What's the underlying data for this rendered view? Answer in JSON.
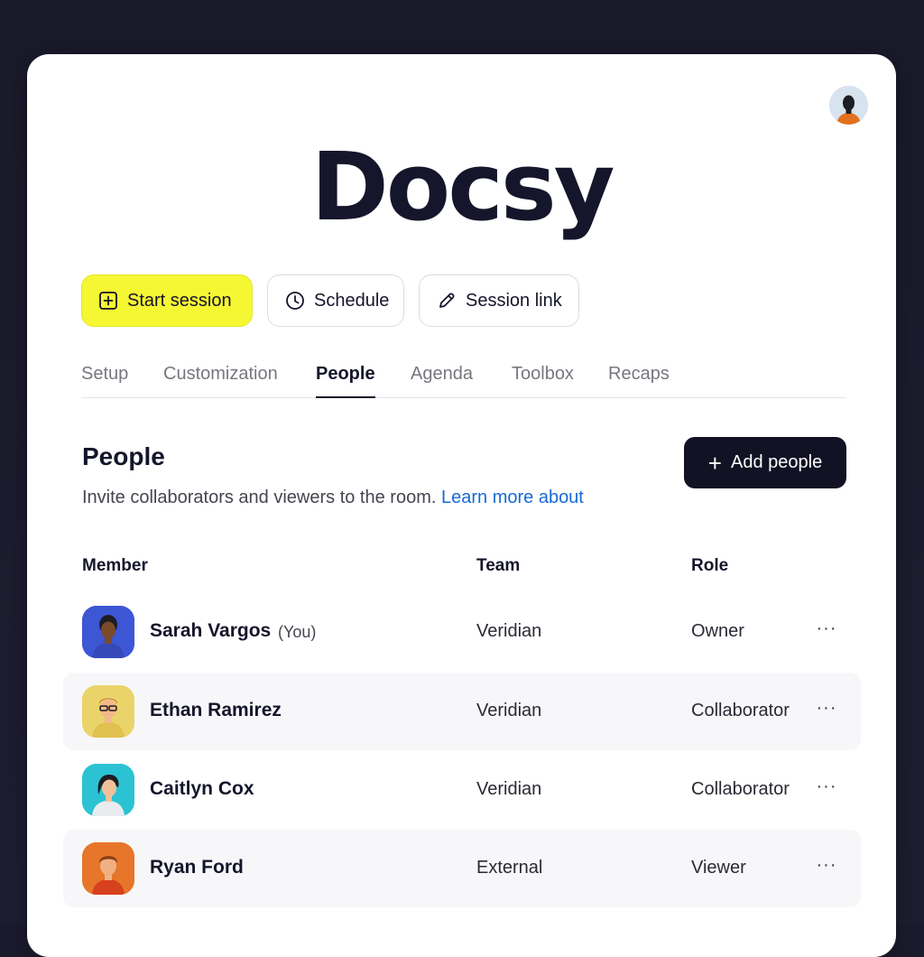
{
  "app": {
    "logo": "Docsy"
  },
  "actions": {
    "start_session": "Start session",
    "schedule": "Schedule",
    "session_link": "Session link"
  },
  "tabs": [
    {
      "label": "Setup",
      "active": false
    },
    {
      "label": "Customization",
      "active": false
    },
    {
      "label": "People",
      "active": true
    },
    {
      "label": "Agenda",
      "active": false
    },
    {
      "label": "Toolbox",
      "active": false
    },
    {
      "label": "Recaps",
      "active": false
    }
  ],
  "people": {
    "title": "People",
    "description": "Invite collaborators and viewers to the room.",
    "learn_more": "Learn more about",
    "add_button": "Add people",
    "add_icon": "plus-icon",
    "columns": {
      "member": "Member",
      "team": "Team",
      "role": "Role"
    },
    "members": [
      {
        "name": "Sarah Vargos",
        "you_label": "(You)",
        "team": "Veridian",
        "role": "Owner",
        "more": "···",
        "avatar_bg": "#3d56d4"
      },
      {
        "name": "Ethan Ramirez",
        "you_label": "",
        "team": "Veridian",
        "role": "Collaborator",
        "more": "···",
        "avatar_bg": "#ead46a"
      },
      {
        "name": "Caitlyn Cox",
        "you_label": "",
        "team": "Veridian",
        "role": "Collaborator",
        "more": "···",
        "avatar_bg": "#2bc3d3"
      },
      {
        "name": "Ryan Ford",
        "you_label": "",
        "team": "External",
        "role": "Viewer",
        "more": "···",
        "avatar_bg": "#e7762a"
      }
    ]
  },
  "colors": {
    "primary_button": "#f6f733",
    "dark": "#121224",
    "link": "#1769d6"
  }
}
